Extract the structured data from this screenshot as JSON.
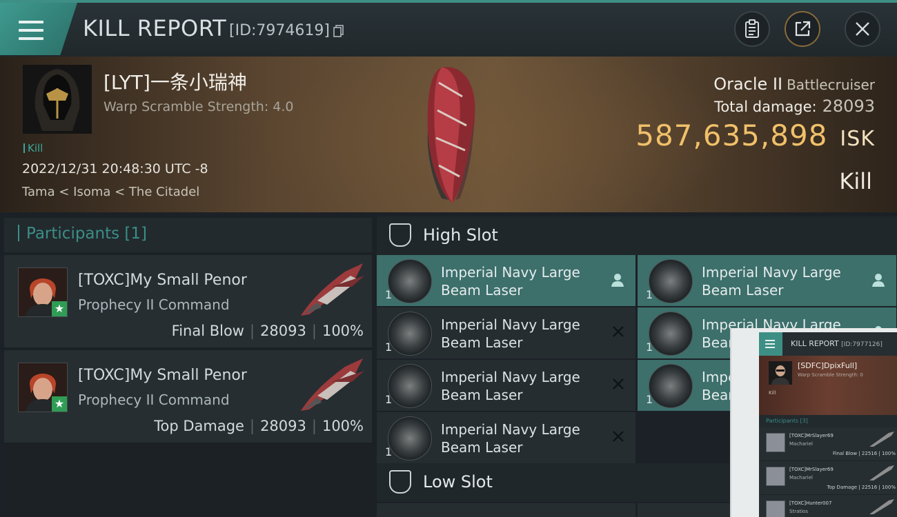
{
  "header": {
    "title": "KILL REPORT",
    "report_id": "[ID:7974619]"
  },
  "victim": {
    "name": "[LYT]一条小瑞神",
    "warp_scramble": "Warp Scramble Strength: 4.0",
    "tag": "Kill",
    "datetime": "2022/12/31 20:48:30 UTC -8",
    "location": "Tama < Isoma < The Citadel",
    "ship_name": "Oracle II",
    "ship_class": "Battlecruiser",
    "total_damage_label": "Total damage:",
    "total_damage": "28093",
    "isk_value": "587,635,898",
    "isk_unit": "ISK",
    "result": "Kill"
  },
  "participants": {
    "title": "Participants [1]",
    "rows": [
      {
        "name": "[TOXC]My Small Penor",
        "ship": "Prophecy II Command",
        "role": "Final Blow",
        "damage": "28093",
        "percent": "100%"
      },
      {
        "name": "[TOXC]My Small Penor",
        "ship": "Prophecy II Command",
        "role": "Top Damage",
        "damage": "28093",
        "percent": "100%"
      }
    ]
  },
  "fitting": {
    "high_slot_label": "High Slot",
    "low_slot_label": "Low Slot",
    "left_modules": [
      {
        "line1": "Imperial Navy Large",
        "line2": "Beam Laser",
        "qty": "1",
        "status": "pilot-icon",
        "active": true
      },
      {
        "line1": "Imperial Navy Large",
        "line2": "Beam Laser",
        "qty": "1",
        "status": "destroyed-icon",
        "active": false
      },
      {
        "line1": "Imperial Navy Large",
        "line2": "Beam Laser",
        "qty": "1",
        "status": "destroyed-icon",
        "active": false
      },
      {
        "line1": "Imperial Navy Large",
        "line2": "Beam Laser",
        "qty": "1",
        "status": "destroyed-icon",
        "active": false
      }
    ],
    "right_modules": [
      {
        "line1": "Imperial Navy Large",
        "line2": "Beam Laser",
        "qty": "1",
        "status": "pilot-icon",
        "active": true
      },
      {
        "line1": "Imperial Navy Large",
        "line2": "Beam Laser",
        "qty": "1",
        "status": "pilot-icon",
        "active": true
      },
      {
        "line1": "Imperial Navy Large",
        "line2": "Beam Laser",
        "qty": "1",
        "status": "pilot-icon",
        "active": true
      }
    ]
  },
  "inset": {
    "title": "KILL REPORT",
    "report_id": "[ID:7977126]",
    "pilot": "[SDFC]DpixFull]",
    "participants": "Participants [3]",
    "rows": [
      {
        "name": "[TOXC]MrSlayer69",
        "ship": "Machariel",
        "stats": "Final Blow | 22516 | 100%"
      },
      {
        "name": "[TOXC]MrSlayer69",
        "ship": "Machariel",
        "stats": "Top Damage | 22516 | 100%"
      },
      {
        "name": "[TOXC]Hunter007",
        "ship": "Stratios",
        "stats": ""
      }
    ]
  },
  "colors": {
    "accent": "#3e8f86",
    "isk": "#f0c06a",
    "active_module": "#3d6f6b"
  }
}
